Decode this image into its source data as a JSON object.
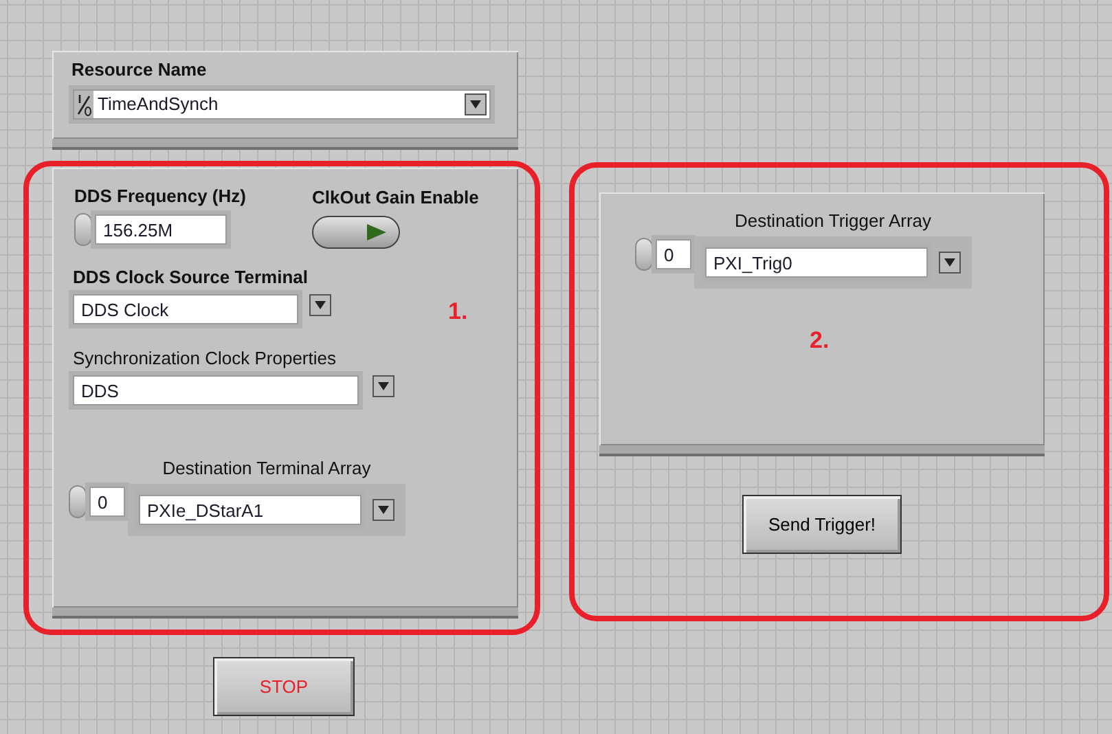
{
  "resource_name": {
    "label": "Resource Name",
    "value": "TimeAndSynch"
  },
  "cluster_1": {
    "annotation": "1.",
    "dds_frequency": {
      "label": "DDS Frequency (Hz)",
      "value": "156.25M"
    },
    "clkout_gain_enable": {
      "label": "ClkOut Gain Enable",
      "on": true
    },
    "dds_clock_source_terminal": {
      "label": "DDS Clock Source Terminal",
      "value": "DDS Clock"
    },
    "synchronization_clock_properties": {
      "label": "Synchronization Clock Properties",
      "value": "DDS"
    },
    "destination_terminal_array": {
      "label": "Destination Terminal Array",
      "index": "0",
      "value": "PXIe_DStarA1"
    }
  },
  "cluster_2": {
    "annotation": "2.",
    "destination_trigger_array": {
      "label": "Destination Trigger Array",
      "index": "0",
      "value": "PXI_Trig0"
    }
  },
  "buttons": [
    {
      "label": "Send Trigger!",
      "kind": "send"
    },
    {
      "label": "STOP",
      "kind": "stop"
    }
  ]
}
